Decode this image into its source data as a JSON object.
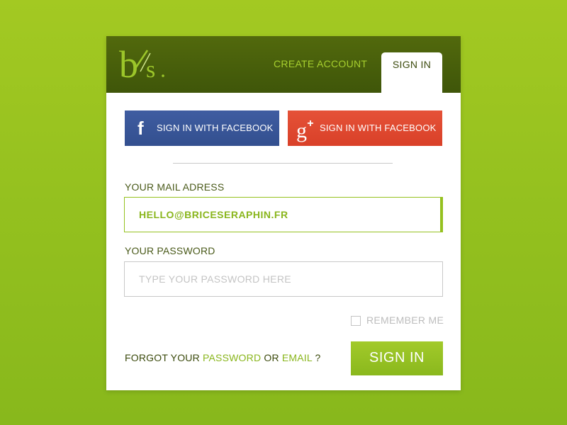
{
  "theme": {
    "background": "#95c11f",
    "header": "#4a600b",
    "accent": "#95c11f",
    "facebook": "#3a5795",
    "google_plus": "#dd4b39"
  },
  "header": {
    "logo_alt": "b's",
    "tabs": {
      "create_account": "CREATE ACCOUNT",
      "sign_in": "SIGN IN"
    }
  },
  "social": {
    "facebook": {
      "icon": "facebook-icon",
      "glyph": "f",
      "label": "SIGN IN WITH FACEBOOK"
    },
    "google_plus": {
      "icon": "google-plus-icon",
      "glyph": "g",
      "glyph_sup": "+",
      "label": "SIGN IN WITH FACEBOOK"
    }
  },
  "form": {
    "mail": {
      "label": "YOUR MAIL ADRESS",
      "value": "HELLO@BRICESERAPHIN.FR"
    },
    "password": {
      "label": "YOUR PASSWORD",
      "placeholder": "TYPE YOUR PASSWORD HERE",
      "value": ""
    },
    "remember_me": {
      "label": "REMEMBER ME",
      "checked": false
    },
    "forgot": {
      "prefix": "FORGOT YOUR ",
      "password_link": "PASSWORD",
      "middle": " OR ",
      "email_link": "EMAIL",
      "suffix": " ?"
    },
    "submit_label": "SIGN IN"
  }
}
